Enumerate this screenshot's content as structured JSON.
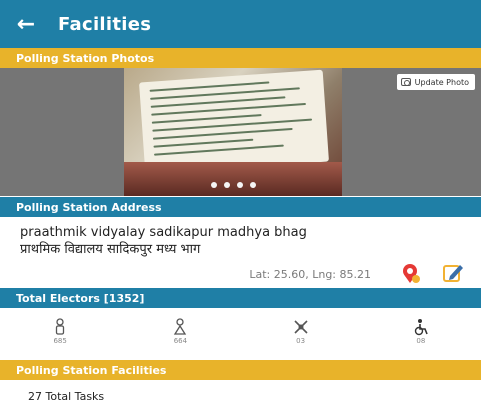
{
  "header": {
    "title": "Facilities"
  },
  "photos": {
    "section_title": "Polling Station Photos",
    "update_label": "Update Photo",
    "slide_count": 4
  },
  "address": {
    "section_title": "Polling Station Address",
    "english": "praathmik vidyalay sadikapur madhya bhag",
    "hindi": "प्राथमिक विद्यालय सादिकपुर मध्य भाग",
    "latlng": "Lat: 25.60, Lng: 85.21"
  },
  "electors": {
    "section_title": "Total Electors [1352]",
    "items": [
      {
        "icon": "male-icon",
        "count": "685"
      },
      {
        "icon": "female-icon",
        "count": "664"
      },
      {
        "icon": "third-gender-icon",
        "count": "03"
      },
      {
        "icon": "disabled-icon",
        "count": "08"
      }
    ]
  },
  "facilities": {
    "section_title": "Polling Station Facilities",
    "total_tasks": "27 Total Tasks"
  },
  "colors": {
    "primary": "#1f7fa6",
    "accent": "#e8b32a"
  }
}
